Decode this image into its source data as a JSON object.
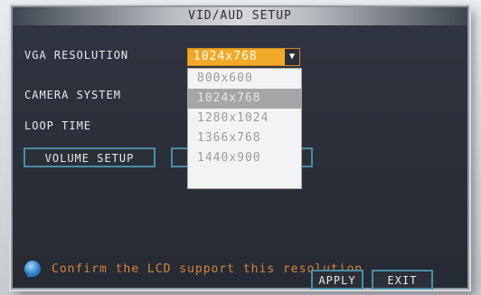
{
  "dialog": {
    "title": "VID/AUD SETUP"
  },
  "settings": {
    "vga_resolution_label": "VGA RESOLUTION",
    "camera_system_label": "CAMERA SYSTEM",
    "loop_time_label": "LOOP TIME"
  },
  "vga_dropdown": {
    "selected": "1024x768",
    "options": [
      "800x600",
      "1024x768",
      "1280x1024",
      "1366x768",
      "1440x900"
    ]
  },
  "buttons": {
    "volume_setup": "VOLUME SETUP",
    "apply": "APPLY",
    "exit": "EXIT"
  },
  "tip": {
    "text": "Confirm the LCD support this resolution"
  },
  "colors": {
    "accent": "#f2a928",
    "tip_text": "#d7863a",
    "button_border": "#4a8ea6"
  }
}
